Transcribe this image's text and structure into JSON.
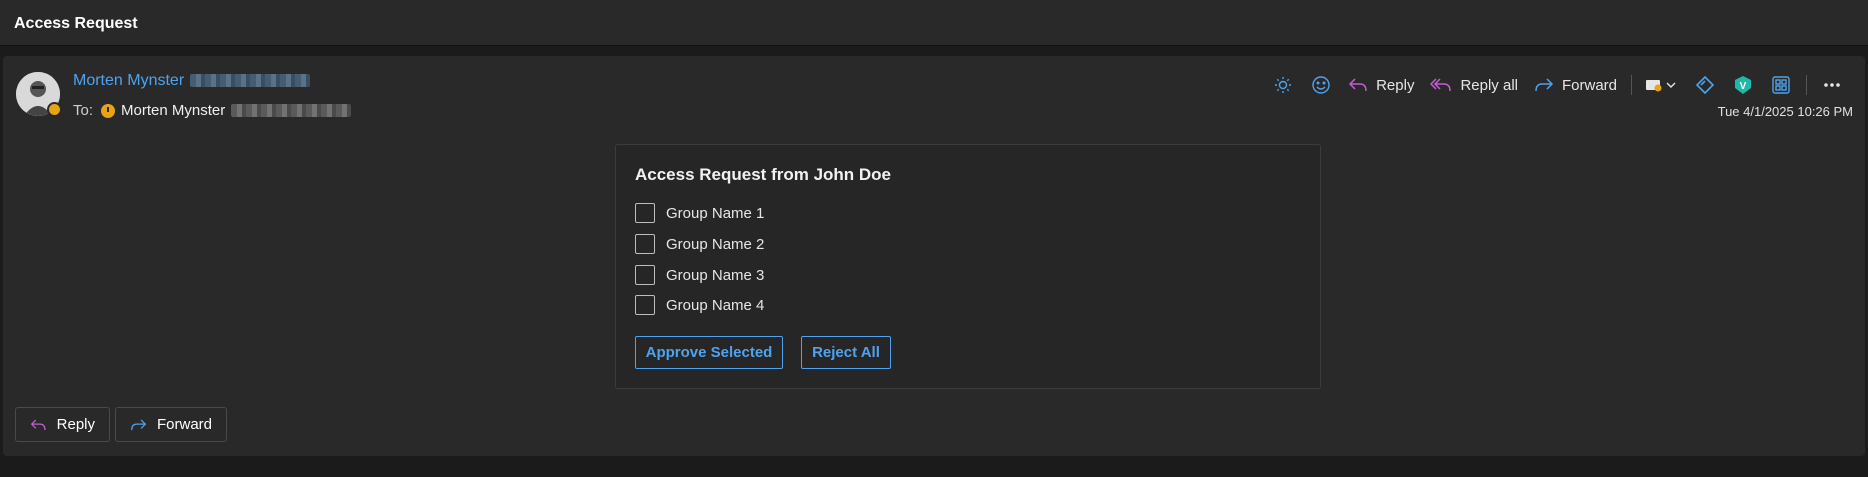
{
  "email": {
    "subject": "Access Request",
    "sender_name": "Morten Mynster",
    "to_label": "To:",
    "recipient_name": "Morten Mynster",
    "date": "Tue 4/1/2025 10:26 PM"
  },
  "toolbar": {
    "reply_label": "Reply",
    "reply_all_label": "Reply all",
    "forward_label": "Forward"
  },
  "adaptive_card": {
    "title": "Access Request from John Doe",
    "choices": [
      "Group Name 1",
      "Group Name 2",
      "Group Name 3",
      "Group Name 4"
    ],
    "approve_label": "Approve Selected",
    "reject_label": "Reject All"
  },
  "footer": {
    "reply_label": "Reply",
    "forward_label": "Forward"
  },
  "colors": {
    "accent": "#4fa3ee",
    "reply_icon": "#c75bd6",
    "status": "#e8a416",
    "background": "#292929"
  },
  "icons": [
    "sun-icon",
    "emoji-icon",
    "reply-icon",
    "reply-all-icon",
    "forward-icon",
    "tag-icon",
    "chevron-down-icon",
    "diamond-icon",
    "shield-v-icon",
    "apps-icon",
    "more-icon",
    "clock-icon"
  ]
}
